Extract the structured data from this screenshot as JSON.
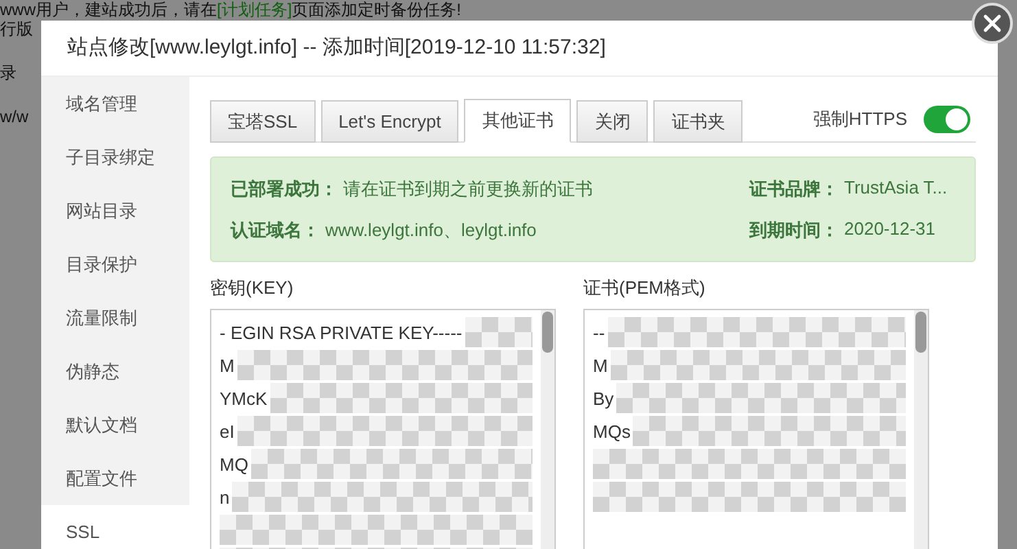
{
  "background": {
    "notice": {
      "before": "www用户，建站成功后，请在",
      "link": "[计划任务]",
      "after": "页面添加定时备份任务!"
    },
    "fragments": [
      "行版",
      "录",
      "w/w"
    ]
  },
  "dialog": {
    "title": "站点修改[www.leylgt.info] -- 添加时间[2019-12-10 11:57:32]"
  },
  "sidebar": {
    "items": [
      {
        "label": "域名管理",
        "selected": false
      },
      {
        "label": "子目录绑定",
        "selected": false
      },
      {
        "label": "网站目录",
        "selected": false
      },
      {
        "label": "目录保护",
        "selected": false
      },
      {
        "label": "流量限制",
        "selected": false
      },
      {
        "label": "伪静态",
        "selected": false
      },
      {
        "label": "默认文档",
        "selected": false
      },
      {
        "label": "配置文件",
        "selected": false
      },
      {
        "label": "SSL",
        "selected": true
      }
    ]
  },
  "tabs": [
    {
      "label": "宝塔SSL",
      "selected": false
    },
    {
      "label": "Let's Encrypt",
      "selected": false
    },
    {
      "label": "其他证书",
      "selected": true
    },
    {
      "label": "关闭",
      "selected": false
    },
    {
      "label": "证书夹",
      "selected": false
    }
  ],
  "force_https": {
    "label": "强制HTTPS",
    "on": true
  },
  "status": {
    "deployed_label": "已部署成功：",
    "deployed_text": "请在证书到期之前更换新的证书",
    "domain_label": "认证域名：",
    "domain_value": "www.leylgt.info、leylgt.info",
    "brand_label": "证书品牌：",
    "brand_value": "TrustAsia T...",
    "expiry_label": "到期时间：",
    "expiry_value": "2020-12-31"
  },
  "key_field": {
    "label": "密钥(KEY)",
    "lines": [
      "- EGIN RSA PRIVATE KEY-----",
      "M",
      "YMcK",
      "eI",
      "MQ",
      "n"
    ]
  },
  "cert_field": {
    "label": "证书(PEM格式)",
    "lines": [
      "--",
      "M",
      "By",
      "MQs"
    ]
  }
}
